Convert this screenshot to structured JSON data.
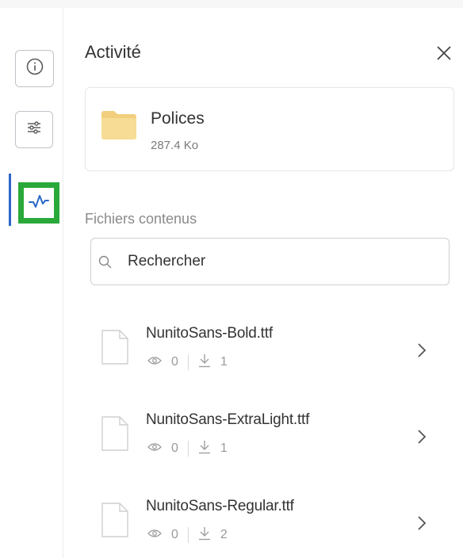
{
  "panel": {
    "title": "Activité"
  },
  "rail": {
    "items": [
      {
        "icon": "info-icon",
        "active": false
      },
      {
        "icon": "sliders-icon",
        "active": false
      },
      {
        "icon": "activity-icon",
        "active": true
      }
    ],
    "active_color": "#2c67c9",
    "highlight_color": "#2aa93a"
  },
  "folder": {
    "name": "Polices",
    "size": "287.4 Ko",
    "icon": "folder-icon",
    "color": "#f5d98a"
  },
  "files_section": {
    "label": "Fichiers contenus",
    "search_placeholder": "Rechercher",
    "items": [
      {
        "name": "NunitoSans-Bold.ttf",
        "views": "0",
        "downloads": "1"
      },
      {
        "name": "NunitoSans-ExtraLight.ttf",
        "views": "0",
        "downloads": "1"
      },
      {
        "name": "NunitoSans-Regular.ttf",
        "views": "0",
        "downloads": "2"
      }
    ]
  }
}
